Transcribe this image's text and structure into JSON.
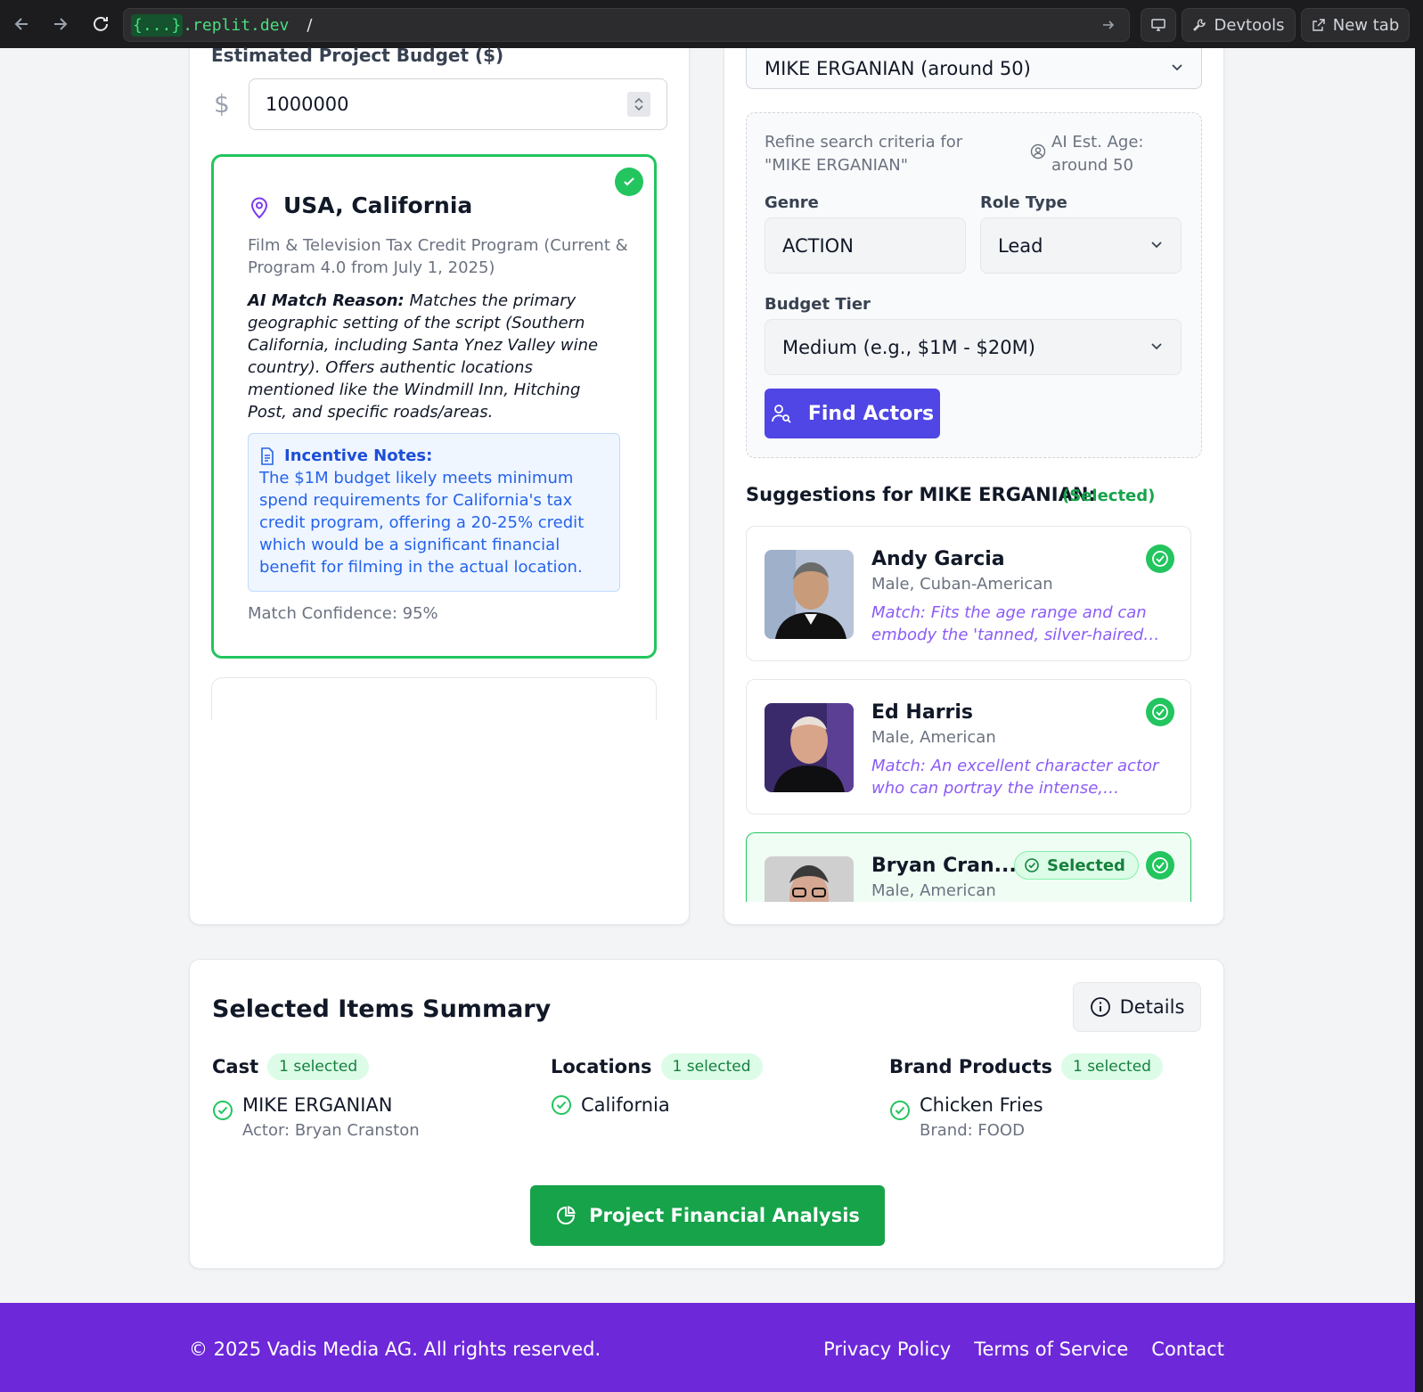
{
  "browser": {
    "url_host_brace": "{...}",
    "url_host": ".replit.dev",
    "url_path": "/",
    "devtools_label": "Devtools",
    "newtab_label": "New tab"
  },
  "budget": {
    "label": "Estimated Project Budget ($)",
    "currency_symbol": "$",
    "value": "1000000"
  },
  "location": {
    "title": "USA, California",
    "program": "Film & Television Tax Credit Program (Current & Program 4.0 from July 1, 2025)",
    "reason_label": "AI Match Reason:",
    "reason_text": " Matches the primary geographic setting of the script (Southern California, including Santa Ynez Valley wine country). Offers authentic locations mentioned like the Windmill Inn, Hitching Post, and specific roads/areas.",
    "incentive_title": "Incentive Notes:",
    "incentive_text": "The $1M budget likely meets minimum spend requirements for California's tax credit program, offering a 20-25% credit which would be a significant financial benefit for filming in the actual location.",
    "confidence": "Match Confidence: 95%"
  },
  "character": {
    "selected": "MIKE ERGANIAN (around 50)",
    "refine_text": "Refine search criteria for \"MIKE ERGANIAN\"",
    "age_text": "AI Est. Age: around 50",
    "genre_label": "Genre",
    "genre_value": "ACTION",
    "role_label": "Role Type",
    "role_value": "Lead",
    "tier_label": "Budget Tier",
    "tier_value": "Medium (e.g., $1M - $20M)",
    "find_label": "Find Actors"
  },
  "suggestions": {
    "title": "Suggestions for MIKE ERGANIAN:",
    "selected_tag": "(Selected)",
    "actors": [
      {
        "name": "Andy Garcia",
        "meta": "Male, Cuban-American",
        "match": "Match: Fits the age range and can embody the 'tanned, silver-haired real estate developer' look"
      },
      {
        "name": "Ed Harris",
        "meta": "Male, American",
        "match": "Match: An excellent character actor who can portray the intense, authoritative presence"
      },
      {
        "name": "Bryan Cran...",
        "meta": "Male, American",
        "badge": "Selected"
      }
    ]
  },
  "summary": {
    "title": "Selected Items Summary",
    "details_label": "Details",
    "cast": {
      "heading": "Cast",
      "pill": "1 selected",
      "primary": "MIKE ERGANIAN",
      "secondary": "Actor: Bryan Cranston"
    },
    "locations": {
      "heading": "Locations",
      "pill": "1 selected",
      "primary": "California"
    },
    "brands": {
      "heading": "Brand Products",
      "pill": "1 selected",
      "primary": "Chicken Fries",
      "secondary": "Brand: FOOD"
    },
    "analysis_label": "Project Financial Analysis"
  },
  "footer": {
    "copyright": "© 2025 Vadis Media AG. All rights reserved.",
    "privacy": "Privacy Policy",
    "terms": "Terms of Service",
    "contact": "Contact"
  }
}
